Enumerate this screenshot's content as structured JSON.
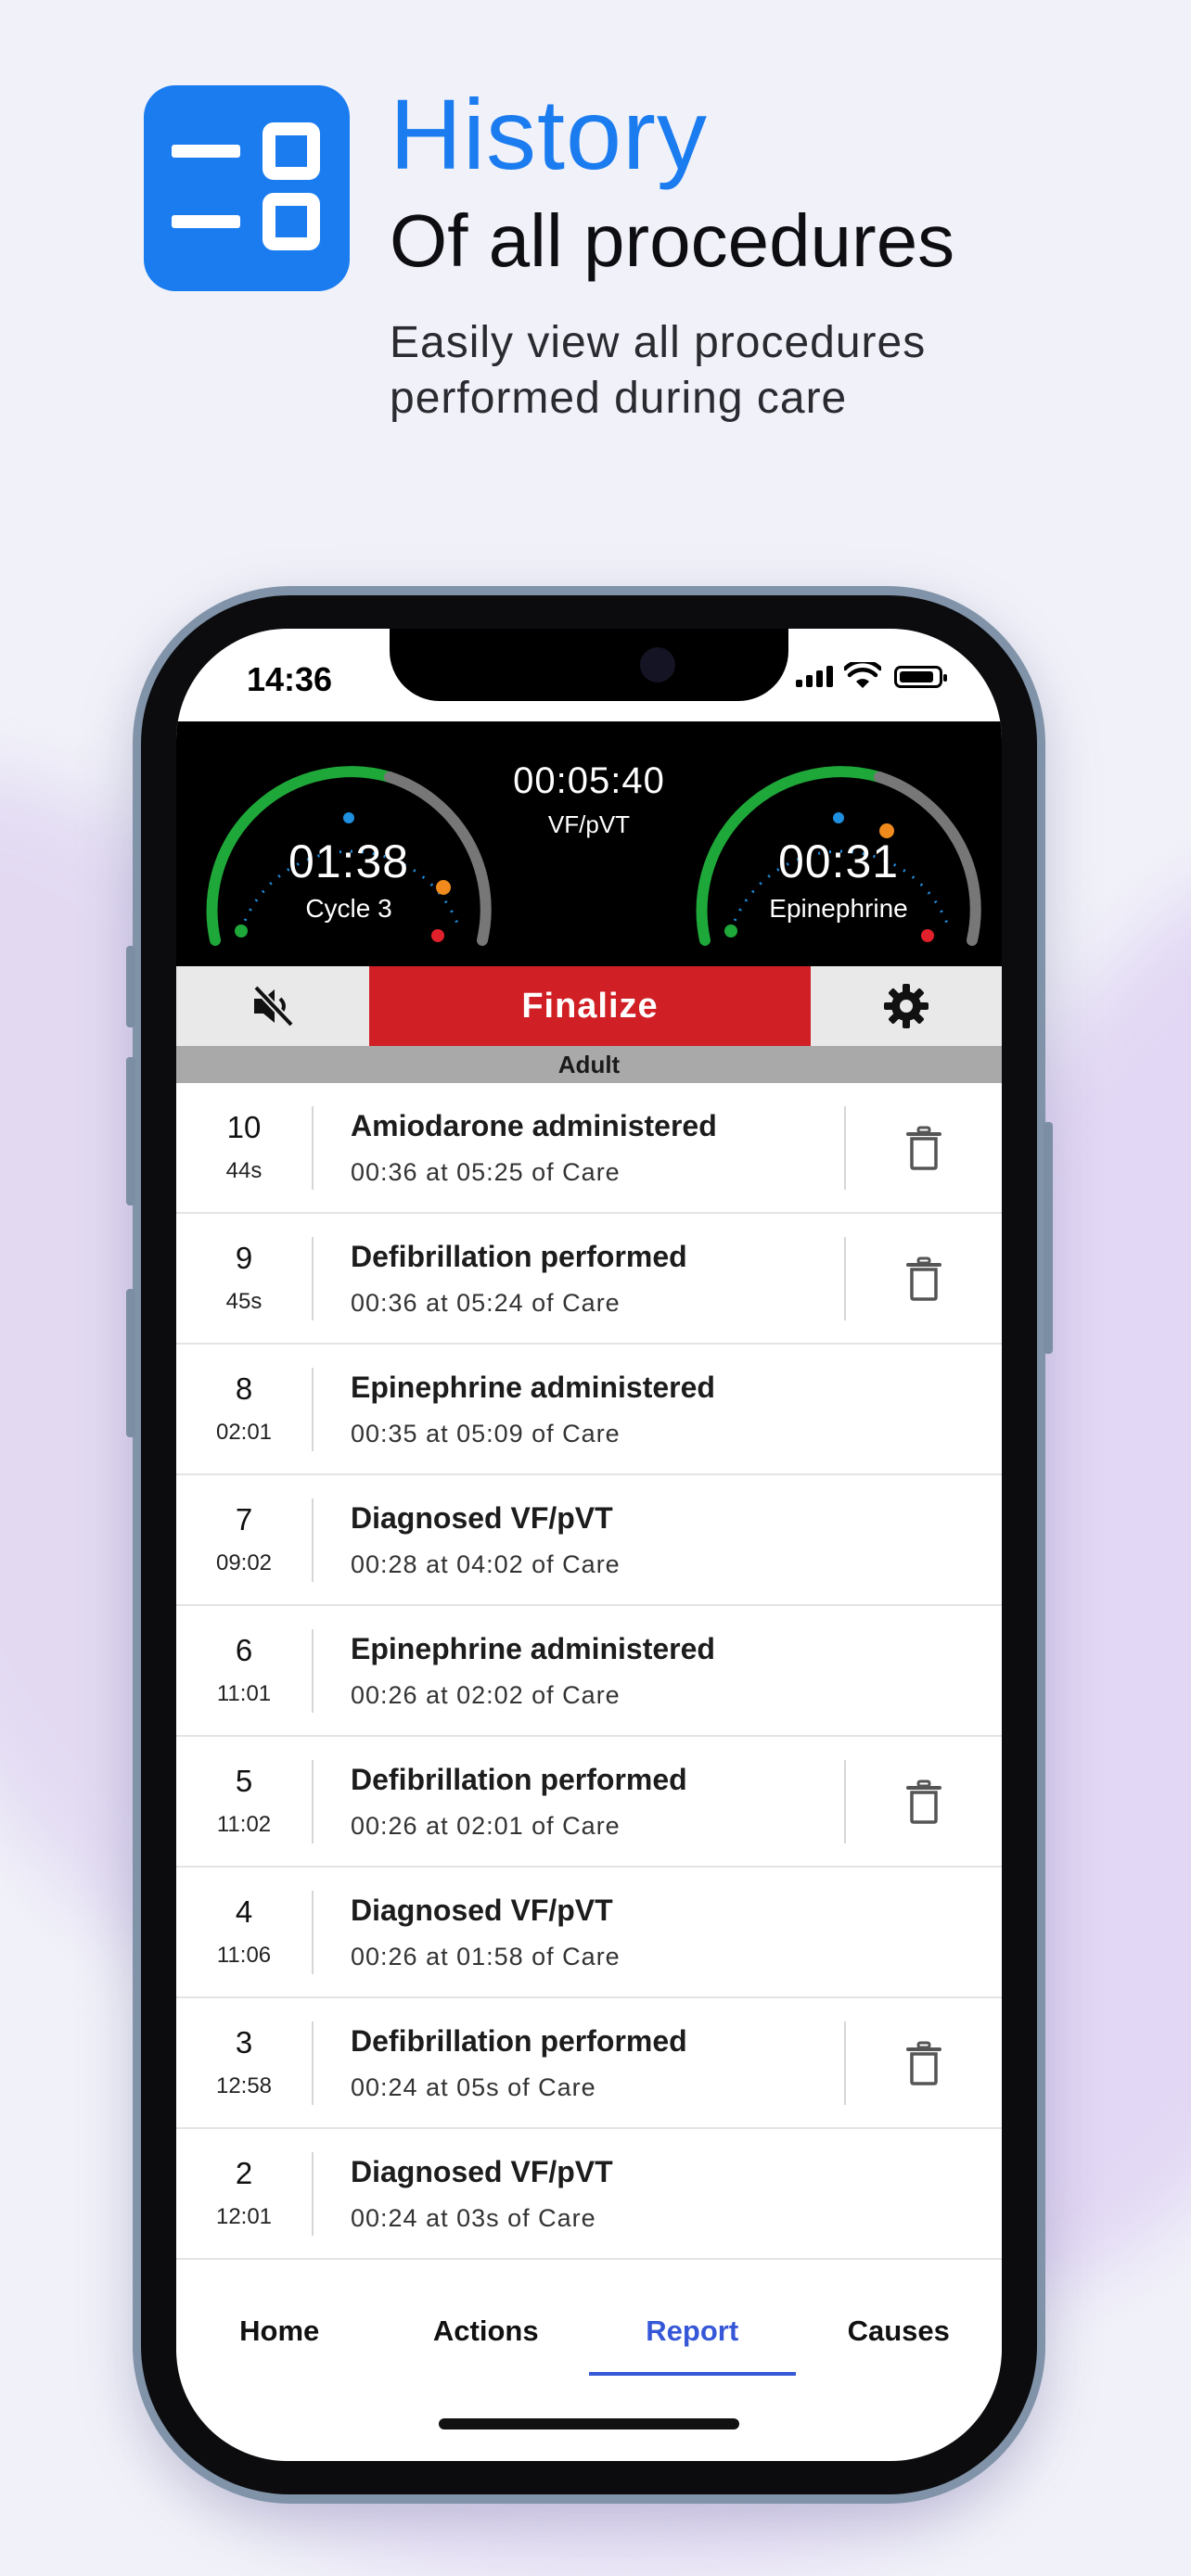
{
  "header": {
    "title": "History",
    "subtitle": "Of all procedures",
    "description": "Easily view all procedures performed during care"
  },
  "status_bar": {
    "time": "14:36"
  },
  "timer": {
    "total_time": "00:05:40",
    "rhythm": "VF/pVT",
    "left_gauge": {
      "time": "01:38",
      "label": "Cycle 3"
    },
    "right_gauge": {
      "time": "00:31",
      "label": "Epinephrine"
    }
  },
  "actions": {
    "finalize_label": "Finalize",
    "mode": "Adult"
  },
  "history": [
    {
      "num": "10",
      "elapsed": "44s",
      "title": "Amiodarone administered",
      "detail": "00:36 at 05:25 of Care",
      "deletable": true
    },
    {
      "num": "9",
      "elapsed": "45s",
      "title": "Defibrillation performed",
      "detail": "00:36 at 05:24 of Care",
      "deletable": true
    },
    {
      "num": "8",
      "elapsed": "02:01",
      "title": "Epinephrine administered",
      "detail": "00:35 at 05:09 of Care",
      "deletable": false
    },
    {
      "num": "7",
      "elapsed": "09:02",
      "title": "Diagnosed VF/pVT",
      "detail": "00:28 at 04:02 of Care",
      "deletable": false
    },
    {
      "num": "6",
      "elapsed": "11:01",
      "title": "Epinephrine administered",
      "detail": "00:26 at 02:02 of Care",
      "deletable": false
    },
    {
      "num": "5",
      "elapsed": "11:02",
      "title": "Defibrillation performed",
      "detail": "00:26 at 02:01 of Care",
      "deletable": true
    },
    {
      "num": "4",
      "elapsed": "11:06",
      "title": "Diagnosed VF/pVT",
      "detail": "00:26 at 01:58 of Care",
      "deletable": false
    },
    {
      "num": "3",
      "elapsed": "12:58",
      "title": "Defibrillation performed",
      "detail": "00:24 at 05s of Care",
      "deletable": true
    },
    {
      "num": "2",
      "elapsed": "12:01",
      "title": "Diagnosed VF/pVT",
      "detail": "00:24 at 03s of Care",
      "deletable": false
    }
  ],
  "nav": {
    "tabs": [
      {
        "label": "Home",
        "active": false
      },
      {
        "label": "Actions",
        "active": false
      },
      {
        "label": "Report",
        "active": true
      },
      {
        "label": "Causes",
        "active": false
      }
    ]
  },
  "colors": {
    "brand_blue": "#1b7cf0",
    "finalize_red": "#d01f25",
    "active_tab": "#3658d8",
    "gauge_green": "#1fa83a",
    "gauge_orange": "#f08a1c",
    "gauge_red": "#e0202a"
  },
  "icons": {
    "mute": "speaker-muted-icon",
    "settings": "gear-icon",
    "delete": "trash-icon"
  }
}
